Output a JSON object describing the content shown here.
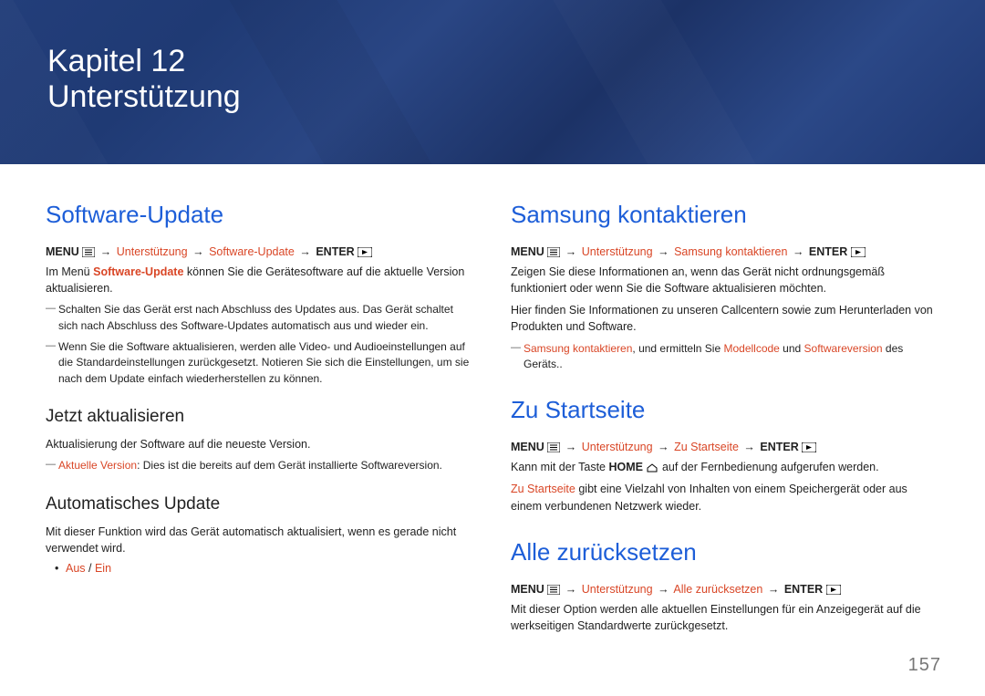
{
  "banner": {
    "chapter": "Kapitel 12",
    "title": "Unterstützung"
  },
  "glyphs": {
    "arrow": "→"
  },
  "left": {
    "h1": "Software-Update",
    "path": {
      "menu": "MENU",
      "p1": "Unterstützung",
      "p2": "Software-Update",
      "enter": "ENTER"
    },
    "intro_a": "Im Menü ",
    "intro_b": "Software-Update",
    "intro_c": " können Sie die Gerätesoftware auf die aktuelle Version aktualisieren.",
    "note1": "Schalten Sie das Gerät erst nach Abschluss des Updates aus. Das Gerät schaltet sich nach Abschluss des Software-Updates automatisch aus und wieder ein.",
    "note2": "Wenn Sie die Software aktualisieren, werden alle Video- und Audioeinstellungen auf die Standardeinstellungen zurückgesetzt. Notieren Sie sich die Einstellungen, um sie nach dem Update einfach wiederherstellen zu können.",
    "jetzt_h": "Jetzt aktualisieren",
    "jetzt_p": "Aktualisierung der Software auf die neueste Version.",
    "jetzt_note_a": "Aktuelle Version",
    "jetzt_note_b": ": Dies ist die bereits auf dem Gerät installierte Softwareversion.",
    "auto_h": "Automatisches Update",
    "auto_p": "Mit dieser Funktion wird das Gerät automatisch aktualisiert, wenn es gerade nicht verwendet wird.",
    "auto_aus": "Aus",
    "auto_sep": " / ",
    "auto_ein": "Ein"
  },
  "right": {
    "contact_h": "Samsung kontaktieren",
    "contact_path": {
      "menu": "MENU",
      "p1": "Unterstützung",
      "p2": "Samsung kontaktieren",
      "enter": "ENTER"
    },
    "contact_p1": "Zeigen Sie diese Informationen an, wenn das Gerät nicht ordnungsgemäß funktioniert oder wenn Sie die Software aktualisieren möchten.",
    "contact_p2": "Hier finden Sie Informationen zu unseren Callcentern sowie zum Herunterladen von Produkten und Software.",
    "contact_note_a": "Samsung kontaktieren",
    "contact_note_b": ", und ermitteln Sie ",
    "contact_note_c": "Modellcode",
    "contact_note_d": " und ",
    "contact_note_e": "Softwareversion",
    "contact_note_f": " des Geräts..",
    "home_h": "Zu Startseite",
    "home_path": {
      "menu": "MENU",
      "p1": "Unterstützung",
      "p2": "Zu Startseite",
      "enter": "ENTER"
    },
    "home_p1a": "Kann mit der Taste ",
    "home_p1b": "HOME",
    "home_p1c": " auf der Fernbedienung aufgerufen werden.",
    "home_p2a": "Zu Startseite",
    "home_p2b": " gibt eine Vielzahl von Inhalten von einem Speichergerät oder aus einem verbundenen Netzwerk wieder.",
    "reset_h": "Alle zurücksetzen",
    "reset_path": {
      "menu": "MENU",
      "p1": "Unterstützung",
      "p2": "Alle zurücksetzen",
      "enter": "ENTER"
    },
    "reset_p": "Mit dieser Option werden alle aktuellen Einstellungen für ein Anzeigegerät auf die werkseitigen Standardwerte zurückgesetzt."
  },
  "pagenum": "157"
}
